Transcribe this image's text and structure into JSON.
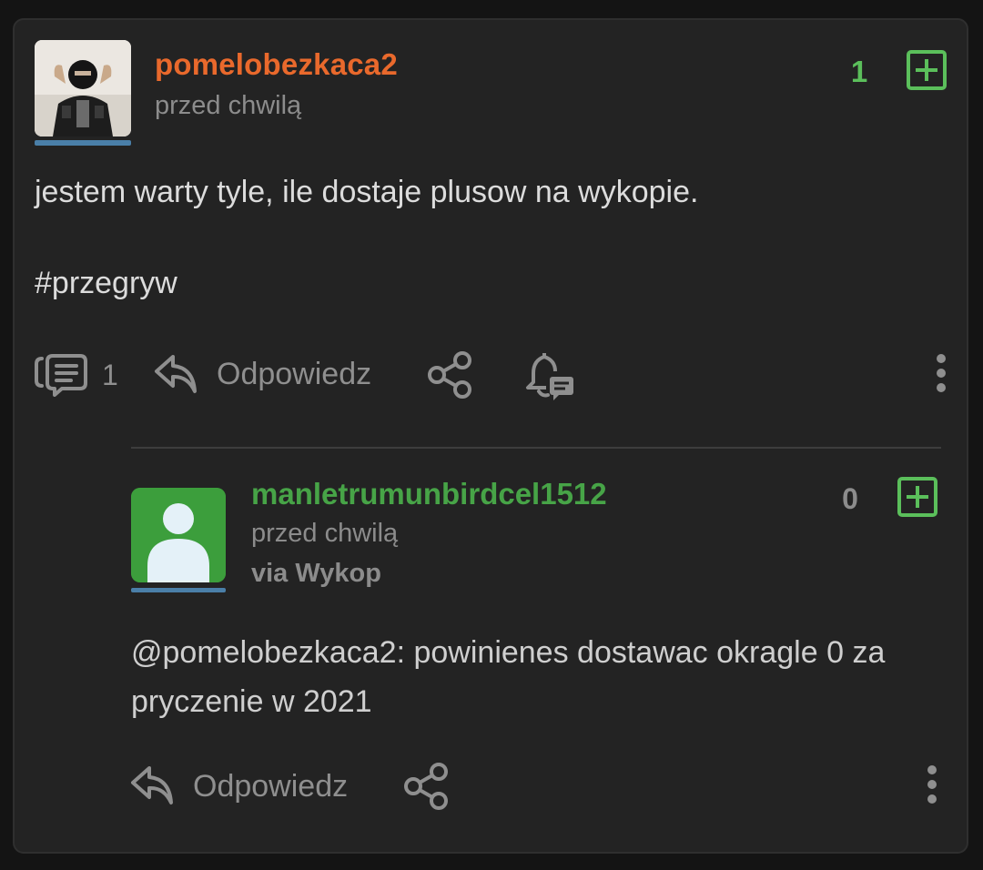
{
  "entry": {
    "author": "pomelobezkaca2",
    "time": "przed chwilą",
    "votes": "1",
    "body": "jestem warty tyle, ile dostaje plusow na wykopie.",
    "tag": "#przegryw",
    "comments_count": "1",
    "reply_label": "Odpowiedz"
  },
  "comment": {
    "author": "manletrumunbirdcel1512",
    "time": "przed chwilą",
    "via": "via Wykop",
    "votes": "0",
    "mention": "@pomelobezkaca2:",
    "body": " powinienes dostawac okragle 0 za pryczenie w 2021",
    "reply_label": "Odpowiedz"
  },
  "colors": {
    "author_orange": "#e9692c",
    "author_green": "#47a447",
    "vote_green": "#5bbf5b",
    "underline_blue": "#4a7fa8"
  },
  "icons": [
    "comments-icon",
    "reply-icon",
    "share-icon",
    "bell-icon",
    "more-icon",
    "plus-icon",
    "avatar-placeholder-icon"
  ]
}
